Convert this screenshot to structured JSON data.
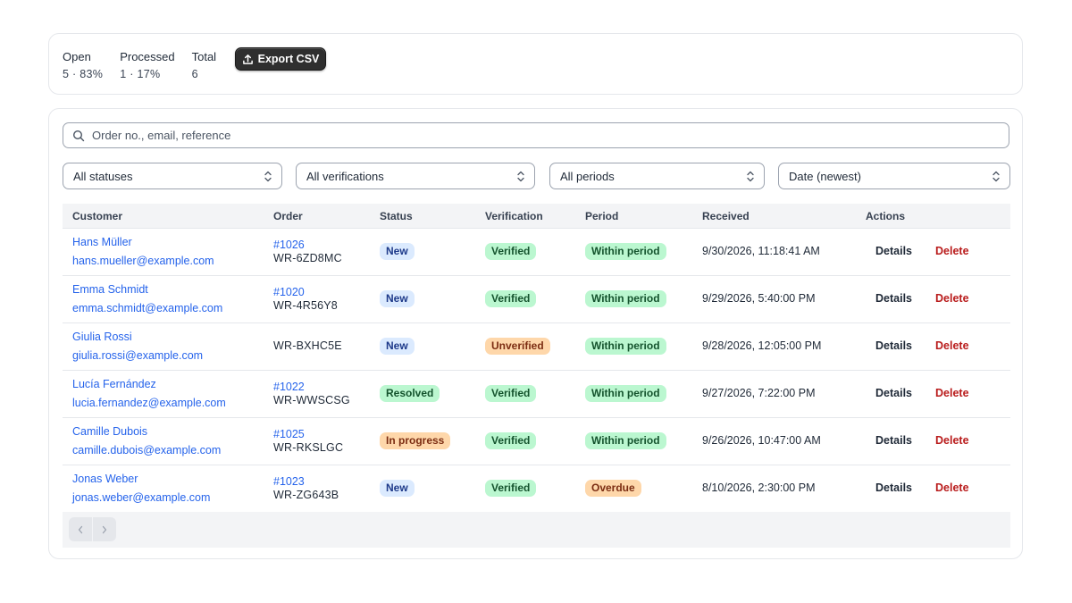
{
  "summary": {
    "stats": [
      {
        "label": "Open",
        "value": "5 · 83%"
      },
      {
        "label": "Processed",
        "value": "1 · 17%"
      },
      {
        "label": "Total",
        "value": "6"
      }
    ],
    "export_label": "Export CSV"
  },
  "search": {
    "placeholder": "Order no., email, reference",
    "value": ""
  },
  "filters": {
    "status": "All statuses",
    "verification": "All verifications",
    "period": "All periods",
    "sort": "Date (newest)"
  },
  "table": {
    "headers": {
      "customer": "Customer",
      "order": "Order",
      "status": "Status",
      "verification": "Verification",
      "period": "Period",
      "received": "Received",
      "actions": "Actions"
    },
    "rows": [
      {
        "name": "Hans Müller",
        "email": "hans.mueller@example.com",
        "order_no": "#1026",
        "ref": "WR-6ZD8MC",
        "status": "New",
        "verification": "Verified",
        "period": "Within period",
        "received": "9/30/2026, 11:18:41 AM",
        "details": "Details",
        "delete": "Delete"
      },
      {
        "name": "Emma Schmidt",
        "email": "emma.schmidt@example.com",
        "order_no": "#1020",
        "ref": "WR-4R56Y8",
        "status": "New",
        "verification": "Verified",
        "period": "Within period",
        "received": "9/29/2026, 5:40:00 PM",
        "details": "Details",
        "delete": "Delete"
      },
      {
        "name": "Giulia Rossi",
        "email": "giulia.rossi@example.com",
        "order_no": "",
        "ref": "WR-BXHC5E",
        "status": "New",
        "verification": "Unverified",
        "period": "Within period",
        "received": "9/28/2026, 12:05:00 PM",
        "details": "Details",
        "delete": "Delete"
      },
      {
        "name": "Lucía Fernández",
        "email": "lucia.fernandez@example.com",
        "order_no": "#1022",
        "ref": "WR-WWSCSG",
        "status": "Resolved",
        "verification": "Verified",
        "period": "Within period",
        "received": "9/27/2026, 7:22:00 PM",
        "details": "Details",
        "delete": "Delete"
      },
      {
        "name": "Camille Dubois",
        "email": "camille.dubois@example.com",
        "order_no": "#1025",
        "ref": "WR-RKSLGC",
        "status": "In progress",
        "verification": "Verified",
        "period": "Within period",
        "received": "9/26/2026, 10:47:00 AM",
        "details": "Details",
        "delete": "Delete"
      },
      {
        "name": "Jonas Weber",
        "email": "jonas.weber@example.com",
        "order_no": "#1023",
        "ref": "WR-ZG643B",
        "status": "New",
        "verification": "Verified",
        "period": "Overdue",
        "received": "8/10/2026, 2:30:00 PM",
        "details": "Details",
        "delete": "Delete"
      }
    ]
  },
  "colors": {
    "link": "#2563eb",
    "delete": "#b91c1c",
    "badge_new": "#dbeafe",
    "badge_green": "#bbf7d0",
    "badge_orange": "#fed7aa"
  },
  "icons": {
    "export": "upload-icon",
    "search": "search-icon",
    "select": "chevron-up-down-icon",
    "prev": "chevron-left-icon",
    "next": "chevron-right-icon"
  }
}
